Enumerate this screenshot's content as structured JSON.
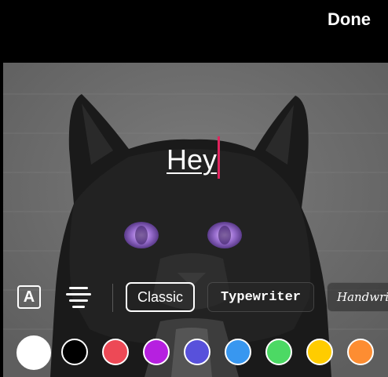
{
  "header": {
    "done_label": "Done"
  },
  "editor": {
    "text_value": "Hey"
  },
  "toolbar": {
    "background_toggle_glyph": "A",
    "align_icon": "align-center-icon",
    "styles": [
      {
        "label": "Classic",
        "selected": true
      },
      {
        "label": "Typewriter",
        "selected": false
      },
      {
        "label": "Handwriting",
        "selected": false
      }
    ]
  },
  "colors": {
    "caret": "#e0245e",
    "swatches": [
      "#ffffff",
      "#000000",
      "#ed4956",
      "#b620e0",
      "#5851db",
      "#3897f0",
      "#4cd964",
      "#ffcc00",
      "#fd8d32"
    ],
    "selected_index": 0
  }
}
